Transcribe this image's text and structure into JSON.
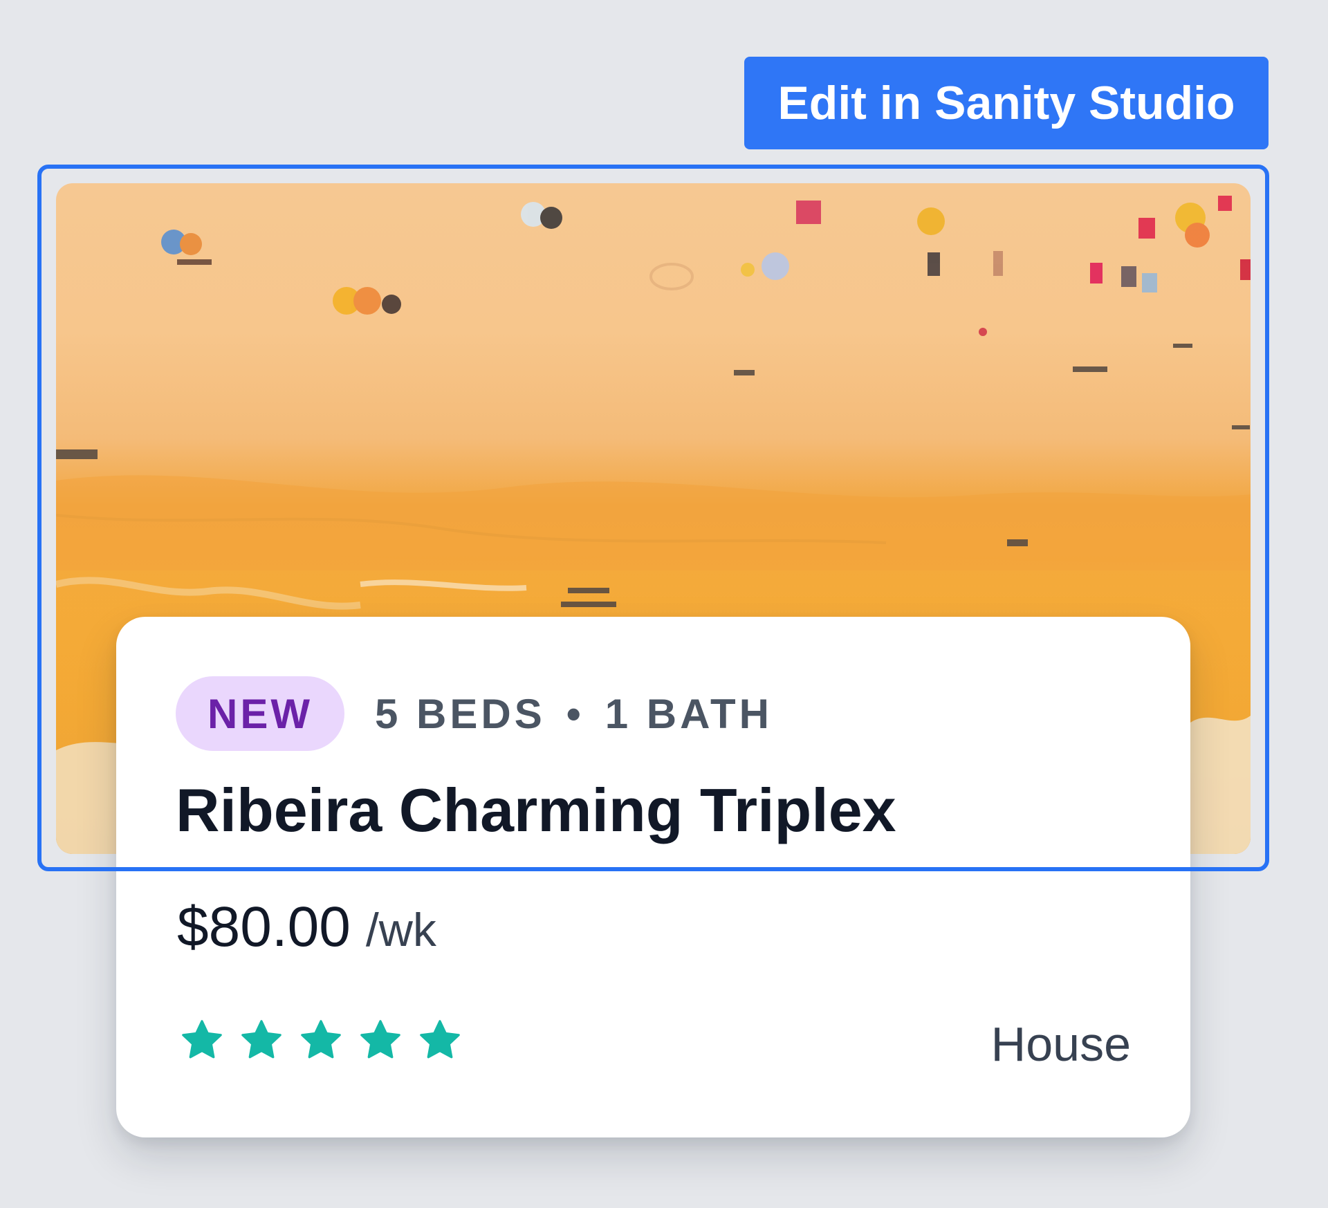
{
  "toolbar": {
    "edit_label": "Edit in Sanity Studio"
  },
  "listing": {
    "image_alt": "Aerial view of a sandy beach with umbrellas and swimmers",
    "badge": "NEW",
    "beds": "5 BEDS",
    "separator": "•",
    "baths": "1 BATH",
    "title": "Ribeira Charming Triplex",
    "price": "$80.00",
    "price_unit": "/wk",
    "rating": 5,
    "rating_max": 5,
    "type": "House"
  },
  "colors": {
    "accent": "#2f76f6",
    "selection": "#2872f5",
    "badge_bg": "#ead7fd",
    "badge_text": "#6b21a8",
    "star": "#14b8a6",
    "background": "#e5e7eb"
  },
  "icons": {
    "star": "star-icon"
  }
}
